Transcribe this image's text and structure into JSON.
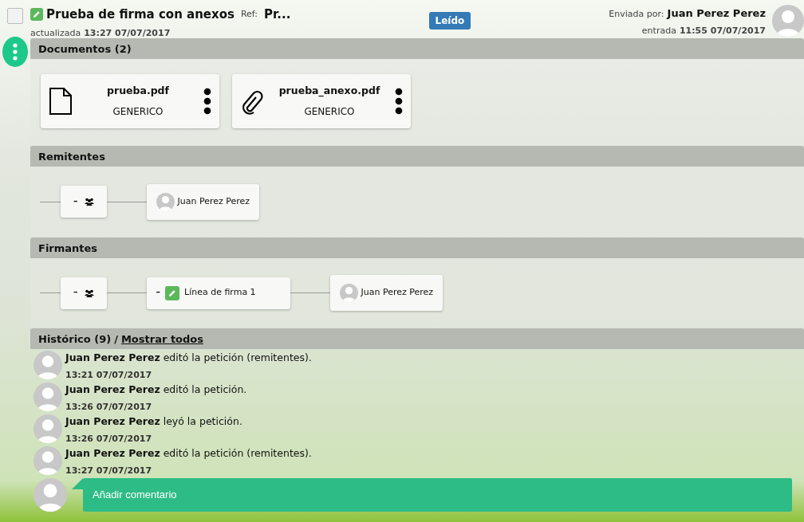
{
  "header": {
    "checked": false,
    "title": "Prueba de firma con anexos",
    "ref_label": "Ref:",
    "ref": "Pr...",
    "updated_label": "actualizada",
    "updated": "13:27 07/07/2017",
    "status": "Leído",
    "sent_by_label": "Enviada por:",
    "sender": "Juan Perez Perez",
    "received_label": "entrada",
    "received": "11:55 07/07/2017"
  },
  "documents": {
    "title": "Documentos (2)",
    "items": [
      {
        "kind": "file",
        "name": "prueba.pdf",
        "type": "GENERICO"
      },
      {
        "kind": "attachment",
        "name": "prueba_anexo.pdf",
        "type": "GENERICO"
      }
    ]
  },
  "senders": {
    "title": "Remitentes",
    "nodes": [
      {
        "kind": "group",
        "toggle": "–"
      },
      {
        "kind": "person",
        "name": "Juan Perez Perez"
      }
    ]
  },
  "signers": {
    "title": "Firmantes",
    "nodes": [
      {
        "kind": "group",
        "toggle": "–"
      },
      {
        "kind": "line",
        "toggle": "–",
        "label": "Línea de firma 1"
      },
      {
        "kind": "person",
        "name": "Juan Perez Perez"
      }
    ]
  },
  "history": {
    "title": "Histórico (9)",
    "separator": "/",
    "link": "Mostrar todos",
    "entries": [
      {
        "user": "Juan Perez Perez",
        "action": "editó la petición (remitentes).",
        "time": "13:21 07/07/2017"
      },
      {
        "user": "Juan Perez Perez",
        "action": "editó la petición.",
        "time": "13:26 07/07/2017"
      },
      {
        "user": "Juan Perez Perez",
        "action": "leyó la petición.",
        "time": "13:26 07/07/2017"
      },
      {
        "user": "Juan Perez Perez",
        "action": "editó la petición (remitentes).",
        "time": "13:27 07/07/2017"
      }
    ]
  },
  "comment": {
    "label": "Añadir comentario"
  }
}
